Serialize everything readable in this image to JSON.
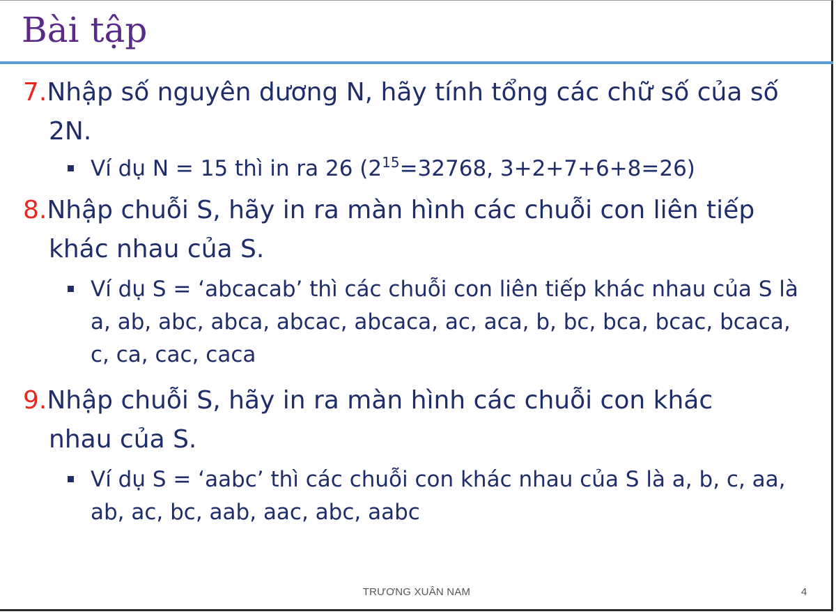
{
  "slide": {
    "title": "Bài tập",
    "items": [
      {
        "number": "7.",
        "text": "Nhập số nguyên dương N, hãy tính tổng các chữ số của số 2N.",
        "example": {
          "before": "Ví dụ N = 15 thì in ra 26 (2",
          "sup": "15",
          "after": "=32768, 3+2+7+6+8=26)"
        }
      },
      {
        "number": "8.",
        "text": "Nhập chuỗi S, hãy in ra màn hình các chuỗi con liên tiếp khác nhau của S.",
        "example": {
          "text": "Ví dụ S = ‘abcacab’ thì các chuỗi con liên tiếp khác nhau của S là a, ab, abc, abca, abcac, abcaca, ac, aca, b, bc, bca, bcac, bcaca, c, ca, cac, caca"
        }
      },
      {
        "number": "9.",
        "text": "Nhập chuỗi S, hãy in ra màn hình các chuỗi con khác nhau của S.",
        "example": {
          "text": "Ví dụ S = ‘aabc’ thì các chuỗi con khác nhau của S là a, b, c, aa, ab, ac, bc, aab, aac, abc, aabc"
        }
      }
    ],
    "footer": "TRƯƠNG XUÂN NAM",
    "page_number": "4"
  },
  "colors": {
    "title": "#5a2a8a",
    "text": "#1f2d6b",
    "number": "#e8281e",
    "rule": "#5b9bd5"
  }
}
